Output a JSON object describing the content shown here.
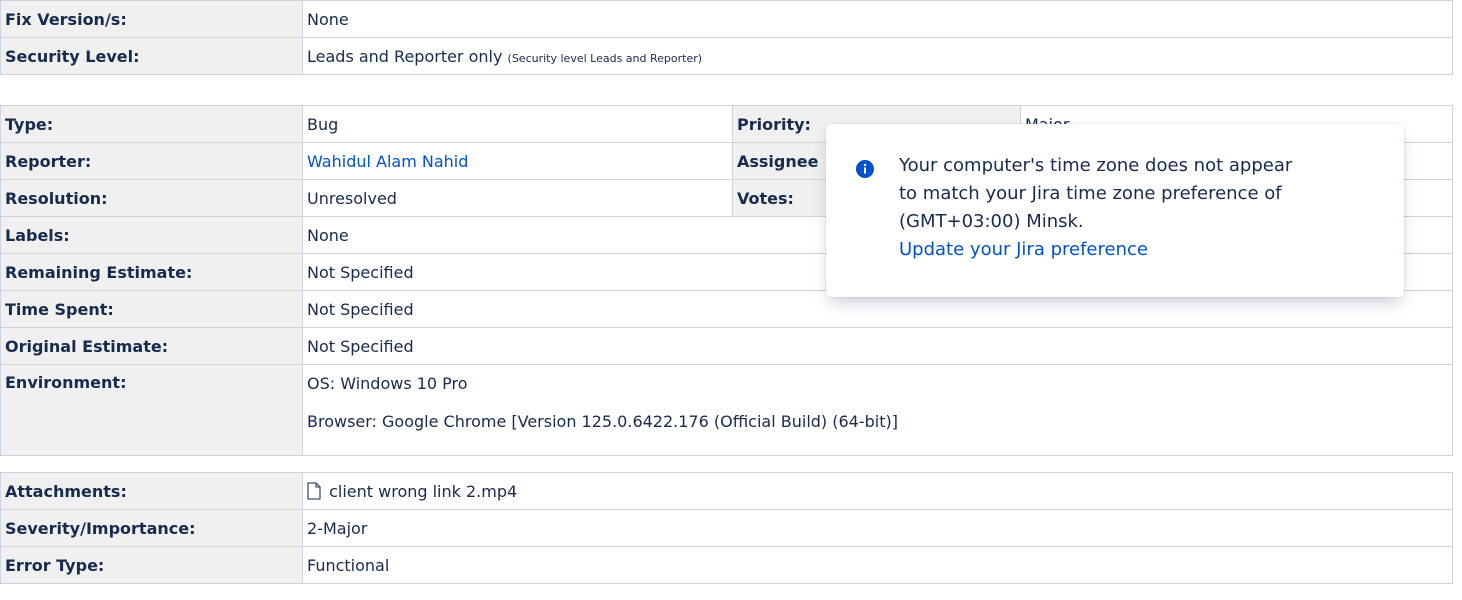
{
  "table_top": [
    {
      "label": "Fix Version/s:",
      "value": "None"
    },
    {
      "label": "Security Level:",
      "value": "Leads and Reporter only",
      "note": "(Security level Leads and Reporter)"
    }
  ],
  "details": {
    "type_label": "Type:",
    "type_value": "Bug",
    "priority_label": "Priority:",
    "priority_value": "Major",
    "reporter_label": "Reporter:",
    "reporter_value": "Wahidul Alam Nahid",
    "assignee_label": "Assignee",
    "resolution_label": "Resolution:",
    "resolution_value": "Unresolved",
    "votes_label": "Votes:",
    "labels_label": "Labels:",
    "labels_value": "None",
    "remaining_label": "Remaining Estimate:",
    "remaining_value": "Not Specified",
    "timespent_label": "Time Spent:",
    "timespent_value": "Not Specified",
    "original_label": "Original Estimate:",
    "original_value": "Not Specified",
    "environment_label": "Environment:",
    "environment_os": "OS: Windows 10 Pro",
    "environment_browser": "Browser: Google Chrome [Version 125.0.6422.176 (Official Build) (64-bit)]"
  },
  "extra": {
    "attachments_label": "Attachments:",
    "attachments_value": "client wrong link 2.mp4",
    "severity_label": "Severity/Importance:",
    "severity_value": "2-Major",
    "errortype_label": "Error Type:",
    "errortype_value": "Functional"
  },
  "popup": {
    "icon": "info-icon",
    "line1": "Your computer's time zone does not appear",
    "line2": "to match your Jira time zone preference of",
    "line3": "(GMT+03:00) Minsk.",
    "link": "Update your Jira preference"
  },
  "colors": {
    "label_bg": "#f0f0f0",
    "border": "#cfd4db",
    "link": "#0052cc",
    "info_blue": "#0052cc"
  }
}
